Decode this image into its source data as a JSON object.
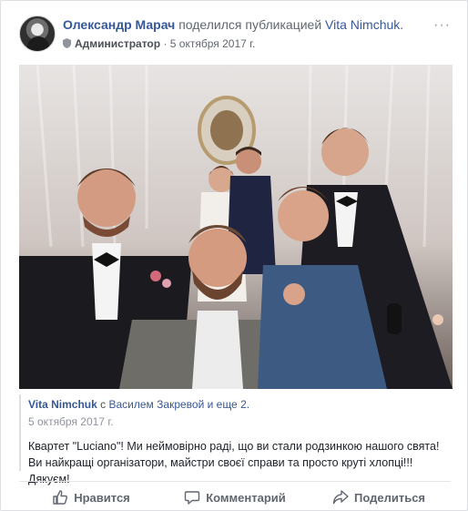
{
  "post": {
    "author": "Олександр Марач",
    "shared_text": "поделился публикацией",
    "page_name": "Vita Nimchuk",
    "page_suffix": ".",
    "role": "Администратор",
    "separator": "·",
    "date": "5 октября 2017 г.",
    "menu_label": "···"
  },
  "shared_post": {
    "author": "Vita Nimchuk",
    "with_text": "с",
    "tagged": "Василем Закревой и еще 2.",
    "date": "5 октября 2017 г.",
    "text": "Квартет \"Luciano\"! Ми неймовірно раді, що ви стали родзинкою нашого свята! Ви найкращі організатори, майстри своєї справи та просто круті хлопці!!! Дякуєм!"
  },
  "actions": [
    {
      "label": "Нравится",
      "icon": "like-icon"
    },
    {
      "label": "Комментарий",
      "icon": "comment-icon"
    },
    {
      "label": "Поделиться",
      "icon": "share-icon"
    }
  ],
  "colors": {
    "link": "#365899",
    "meta": "#606770",
    "background": "#e9ebee"
  }
}
